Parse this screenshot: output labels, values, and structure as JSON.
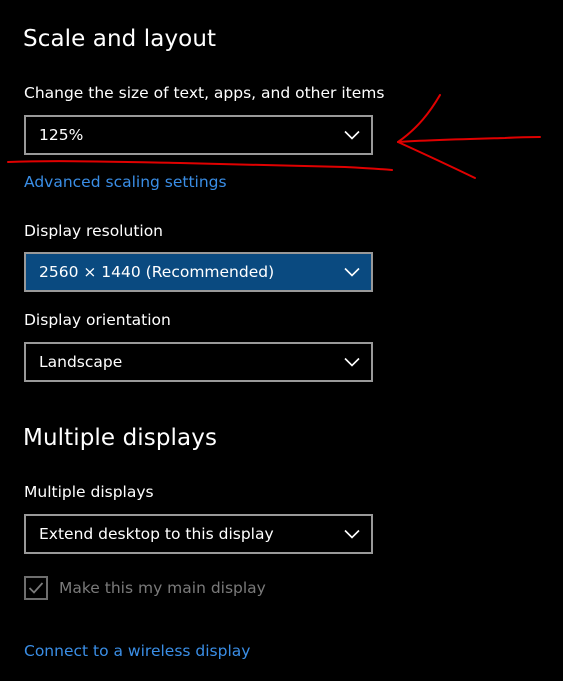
{
  "scale_layout": {
    "title": "Scale and layout",
    "size_label": "Change the size of text, apps, and other items",
    "size_value": "125%",
    "advanced_link": "Advanced scaling settings",
    "resolution_label": "Display resolution",
    "resolution_value": "2560 × 1440 (Recommended)",
    "orientation_label": "Display orientation",
    "orientation_value": "Landscape"
  },
  "multiple_displays": {
    "title": "Multiple displays",
    "label": "Multiple displays",
    "value": "Extend desktop to this display",
    "main_display_label": "Make this my main display",
    "main_display_checked": true,
    "wireless_link": "Connect to a wireless display"
  },
  "icons": {
    "dropdown": "chevron-down-icon",
    "checkbox": "checkmark-icon"
  },
  "colors": {
    "background": "#000000",
    "link": "#3a8ee6",
    "selected_dropdown": "#0a4a80",
    "annotation": "#e00000",
    "disabled_text": "#7a7a7a"
  }
}
